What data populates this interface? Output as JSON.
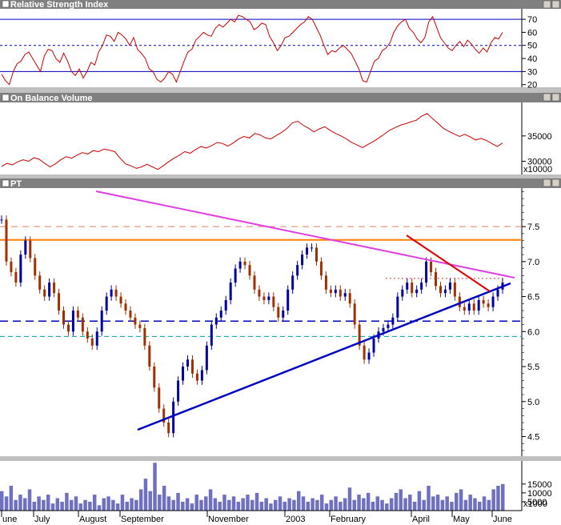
{
  "chart_data": [
    {
      "type": "line",
      "title": "Relative Strength Index",
      "ylim": [
        18,
        78
      ],
      "yticks": [
        "20",
        "30",
        "40",
        "50",
        "60",
        "70"
      ],
      "reference_lines": [
        30,
        50,
        70
      ],
      "series": [
        {
          "values": [
            28,
            23,
            20,
            30,
            36,
            38,
            43,
            45,
            40,
            35,
            30,
            42,
            47,
            46,
            40,
            37,
            44,
            38,
            30,
            27,
            32,
            25,
            30,
            37,
            35,
            45,
            50,
            58,
            57,
            53,
            60,
            58,
            55,
            50,
            56,
            47,
            44,
            40,
            32,
            30,
            24,
            22,
            25,
            30,
            28,
            22,
            30,
            38,
            45,
            47,
            54,
            57,
            60,
            58,
            57,
            63,
            66,
            64,
            67,
            70,
            68,
            73,
            72,
            70,
            68,
            62,
            64,
            67,
            66,
            57,
            52,
            46,
            50,
            56,
            57,
            60,
            63,
            66,
            68,
            72,
            70,
            64,
            58,
            50,
            43,
            46,
            45,
            48,
            50,
            47,
            44,
            38,
            32,
            23,
            22,
            30,
            38,
            40,
            46,
            48,
            52,
            60,
            65,
            68,
            70,
            63,
            60,
            55,
            52,
            56,
            68,
            72,
            64,
            56,
            52,
            48,
            46,
            50,
            53,
            49,
            54,
            51,
            47,
            44,
            48,
            45,
            52,
            56,
            55,
            60
          ]
        }
      ]
    },
    {
      "type": "line",
      "title": "On Balance Volume",
      "ylim": [
        27400,
        41600
      ],
      "yticks": [
        "30000",
        "35000"
      ],
      "unit_label": "x10000",
      "series": [
        {
          "values": [
            29000,
            29600,
            29300,
            29900,
            30300,
            30000,
            30700,
            30400,
            29600,
            28900,
            29500,
            30300,
            30900,
            30600,
            31200,
            31700,
            31400,
            32100,
            31900,
            32400,
            32200,
            31900,
            30600,
            29500,
            29100,
            28600,
            28900,
            29400,
            28900,
            28400,
            29100,
            29900,
            30600,
            31200,
            31900,
            31600,
            32300,
            32900,
            32600,
            33100,
            33700,
            33500,
            33000,
            33600,
            34400,
            34900,
            34600,
            35500,
            35200,
            34600,
            34400,
            35100,
            35700,
            36500,
            37600,
            37900,
            37100,
            36500,
            35800,
            36400,
            36800,
            36100,
            35500,
            35000,
            34400,
            33700,
            33200,
            32700,
            33300,
            33900,
            34600,
            35300,
            36100,
            36600,
            37100,
            37400,
            37800,
            38100,
            38900,
            39400,
            38400,
            37500,
            36500,
            35900,
            35400,
            34900,
            35300,
            34800,
            34200,
            34500,
            34100,
            33500,
            32900,
            33600
          ]
        }
      ]
    },
    {
      "type": "line",
      "title": "PT",
      "ylim": [
        4.22,
        8.05
      ],
      "yticks": [
        "4.5",
        "5.0",
        "5.5",
        "6.0",
        "6.5",
        "7.0",
        "7.5"
      ],
      "xlabel_months": [
        "une",
        "July",
        "August",
        "September",
        "November",
        "2003",
        "February",
        "April",
        "May",
        "June"
      ],
      "horizontal_levels": [
        7.5,
        7.31,
        6.76,
        6.15,
        5.93
      ],
      "series": [
        {
          "values": [
            7.6,
            7.0,
            6.85,
            6.7,
            7.1,
            7.3,
            7.05,
            6.8,
            6.6,
            6.5,
            6.7,
            6.55,
            6.3,
            6.1,
            6.0,
            6.3,
            6.2,
            6.0,
            5.9,
            5.8,
            6.0,
            6.3,
            6.5,
            6.6,
            6.5,
            6.4,
            6.3,
            6.2,
            6.1,
            6.05,
            5.8,
            5.5,
            5.2,
            4.9,
            4.7,
            4.55,
            5.0,
            5.3,
            5.5,
            5.6,
            5.4,
            5.3,
            5.45,
            5.8,
            6.1,
            6.2,
            6.3,
            6.45,
            6.7,
            6.9,
            7.0,
            6.95,
            6.8,
            6.6,
            6.5,
            6.45,
            6.5,
            6.35,
            6.2,
            6.3,
            6.6,
            6.8,
            6.95,
            7.1,
            7.2,
            7.2,
            7.0,
            6.8,
            6.6,
            6.55,
            6.6,
            6.5,
            6.55,
            6.4,
            6.1,
            5.8,
            5.6,
            5.7,
            5.9,
            6.0,
            6.05,
            6.1,
            6.2,
            6.5,
            6.6,
            6.7,
            6.55,
            6.6,
            6.7,
            7.0,
            6.85,
            6.65,
            6.55,
            6.6,
            6.7,
            6.5,
            6.35,
            6.3,
            6.4,
            6.3,
            6.45,
            6.4,
            6.35,
            6.5,
            6.6,
            6.7
          ]
        }
      ]
    },
    {
      "type": "bar",
      "title": "",
      "ylim": [
        0,
        28000
      ],
      "yticks": [
        "5000",
        "10000",
        "15000"
      ],
      "unit_label": "x1000",
      "series": [
        {
          "values": [
            11000,
            8000,
            14000,
            6000,
            9000,
            7000,
            12000,
            5000,
            8000,
            6000,
            9000,
            4000,
            7000,
            5000,
            10000,
            6000,
            8000,
            4000,
            6000,
            5000,
            9000,
            3000,
            7000,
            8000,
            6000,
            4000,
            9000,
            5000,
            7000,
            6000,
            12000,
            18000,
            11000,
            27000,
            9000,
            14000,
            8000,
            6000,
            10000,
            5000,
            7000,
            4000,
            9000,
            6000,
            8000,
            12000,
            7000,
            5000,
            9000,
            6000,
            8000,
            5000,
            7000,
            9000,
            6000,
            10000,
            5000,
            7000,
            4000,
            6000,
            8000,
            5000,
            7000,
            6000,
            11000,
            8000,
            5000,
            7000,
            6000,
            9000,
            4000,
            6000,
            8000,
            5000,
            7000,
            13000,
            6000,
            9000,
            7000,
            10000,
            5000,
            8000,
            6000,
            4000,
            7000,
            10000,
            12000,
            7000,
            9000,
            5000,
            11000,
            6000,
            14000,
            8000,
            9000,
            6000,
            8000,
            5000,
            10000,
            12000,
            6000,
            9000,
            7000,
            5000,
            8000,
            6000,
            12000,
            14000,
            15000
          ]
        }
      ]
    }
  ]
}
